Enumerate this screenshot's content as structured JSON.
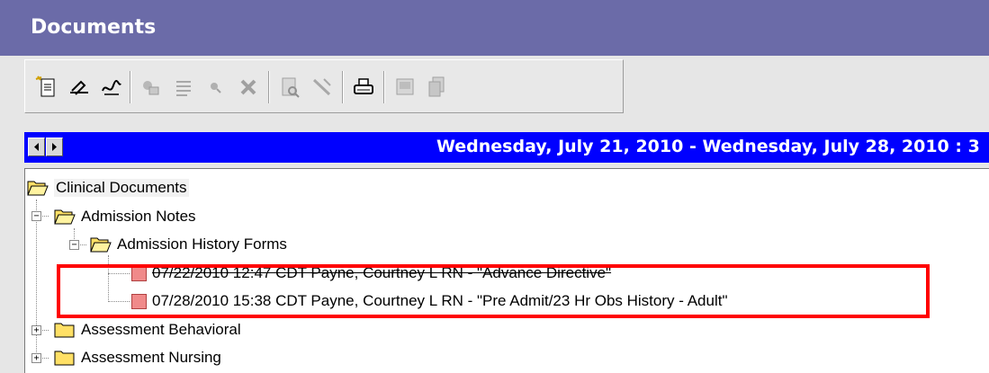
{
  "window": {
    "title": "Documents"
  },
  "toolbar": {
    "buttons": [
      {
        "icon": "new-document-icon"
      },
      {
        "icon": "sign-icon"
      },
      {
        "icon": "sign-review-icon"
      },
      {
        "icon": "forward-icon"
      },
      {
        "icon": "list-icon"
      },
      {
        "icon": "search-icon"
      },
      {
        "icon": "delete-icon"
      },
      {
        "icon": "preview-icon"
      },
      {
        "icon": "modify-icon"
      },
      {
        "icon": "print-icon"
      },
      {
        "icon": "display-icon"
      },
      {
        "icon": "copy-icon"
      }
    ]
  },
  "date_range": {
    "text": "Wednesday, July 21, 2010 - Wednesday, July 28, 2010 : 3"
  },
  "tree": {
    "root": {
      "label": "Clinical Documents"
    },
    "admission_notes": {
      "label": "Admission Notes"
    },
    "admission_history_forms": {
      "label": "Admission History Forms"
    },
    "doc1": {
      "label": "07/22/2010 12:47 CDT Payne, Courtney L RN  - \"Advance Directive\""
    },
    "doc2": {
      "label": "07/28/2010 15:38 CDT Payne, Courtney L RN  - \"Pre Admit/23 Hr Obs History - Adult\""
    },
    "assessment_behavioral": {
      "label": "Assessment Behavioral"
    },
    "assessment_nursing": {
      "label": "Assessment Nursing"
    }
  },
  "colors": {
    "title_bar": "#6b6ba8",
    "date_bar": "#0000ff",
    "highlight_box": "#ff0000"
  }
}
